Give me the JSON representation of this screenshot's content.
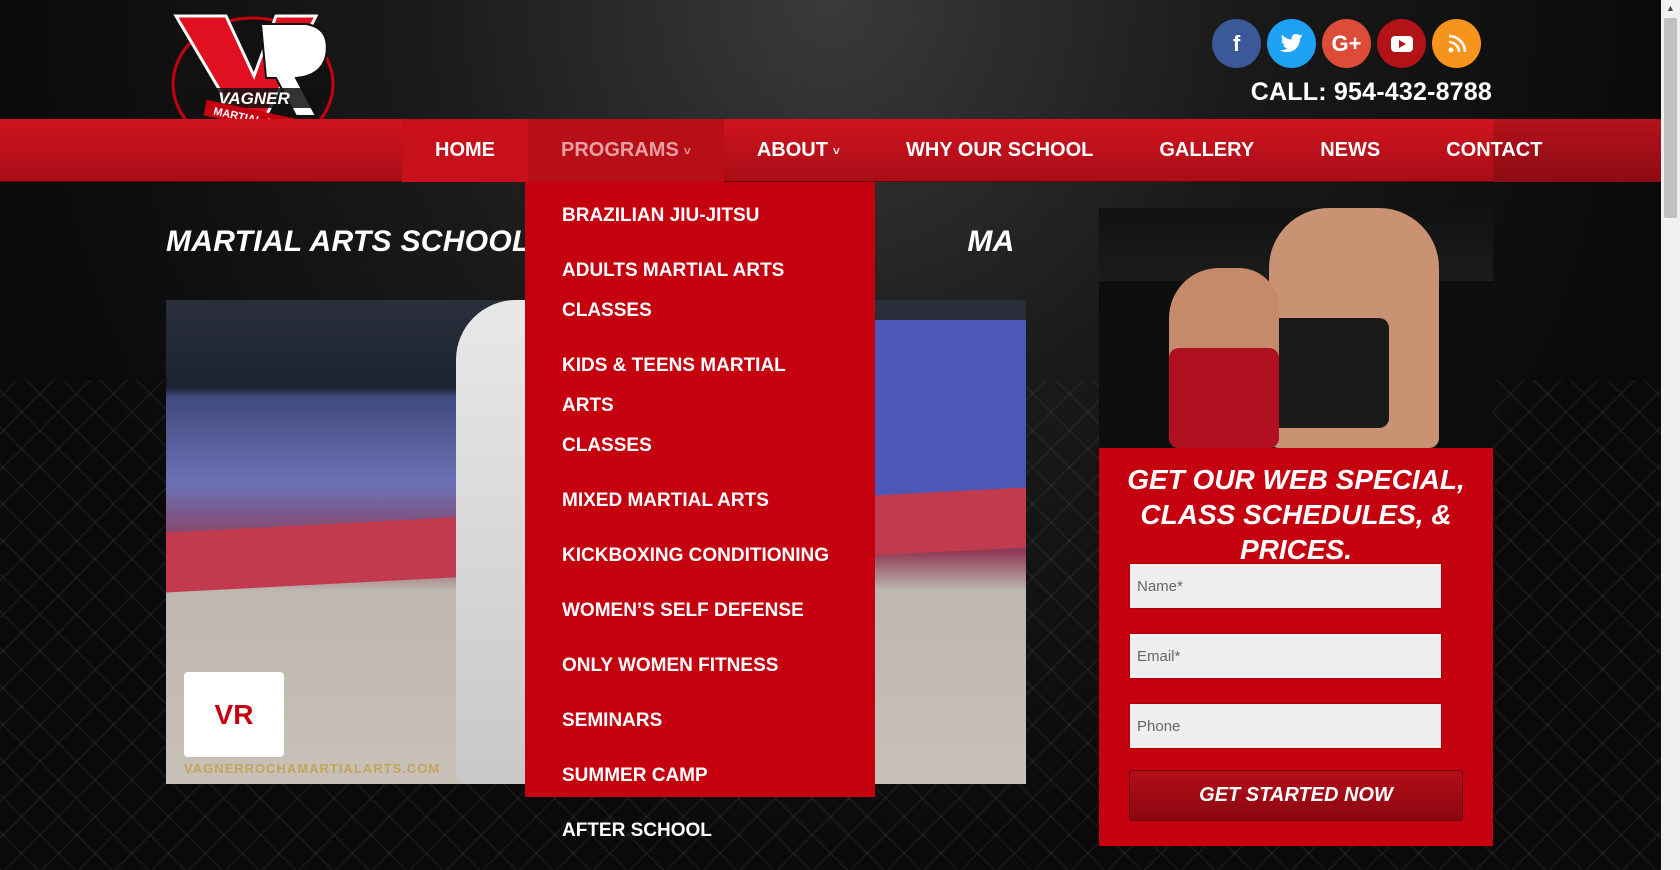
{
  "header": {
    "logo_text": "VAGNER ROCHA MARTIAL ARTS",
    "call": "CALL: 954-432-8788",
    "social": [
      {
        "name": "facebook",
        "glyph": "f",
        "color": "#3b5998"
      },
      {
        "name": "twitter",
        "glyph": "t",
        "color": "#1da1f2"
      },
      {
        "name": "google-plus",
        "glyph": "G+",
        "color": "#dd4b39"
      },
      {
        "name": "youtube",
        "glyph": "▶",
        "color": "#b31217"
      },
      {
        "name": "rss",
        "glyph": "◉",
        "color": "#f7941d"
      }
    ]
  },
  "nav": {
    "items": [
      {
        "label": "HOME"
      },
      {
        "label": "PROGRAMS",
        "caret": "˅"
      },
      {
        "label": "ABOUT",
        "caret": "˅"
      },
      {
        "label": "WHY OUR SCHOOL"
      },
      {
        "label": "GALLERY"
      },
      {
        "label": "NEWS"
      },
      {
        "label": "CONTACT"
      }
    ]
  },
  "dropdown": {
    "items": [
      {
        "label": "BRAZILIAN JIU-JITSU"
      },
      {
        "label": "ADULTS MARTIAL ARTS CLASSES"
      },
      {
        "label_line1": "KIDS & TEENS MARTIAL ARTS",
        "label_line2": "CLASSES"
      },
      {
        "label": "MIXED MARTIAL ARTS"
      },
      {
        "label": "KICKBOXING CONDITIONING"
      },
      {
        "label": "WOMEN’S SELF DEFENSE"
      },
      {
        "label": "ONLY WOMEN FITNESS"
      },
      {
        "label": "SEMINARS"
      },
      {
        "label": "SUMMER CAMP"
      },
      {
        "label": "AFTER SCHOOL"
      }
    ]
  },
  "main": {
    "title": "MARTIAL ARTS SCHOOL PE",
    "title_tail": "MA",
    "video": {
      "watermark_url": "VAGNERROCHAMARTIALARTS.COM"
    }
  },
  "signup": {
    "title": "GET OUR WEB SPECIAL, CLASS SCHEDULES, & PRICES.",
    "name_placeholder": "Name*",
    "email_placeholder": "Email*",
    "phone_placeholder": "Phone",
    "submit": "GET STARTED NOW"
  },
  "colors": {
    "brand_red": "#c5000f",
    "nav_red": "#d0141f"
  }
}
